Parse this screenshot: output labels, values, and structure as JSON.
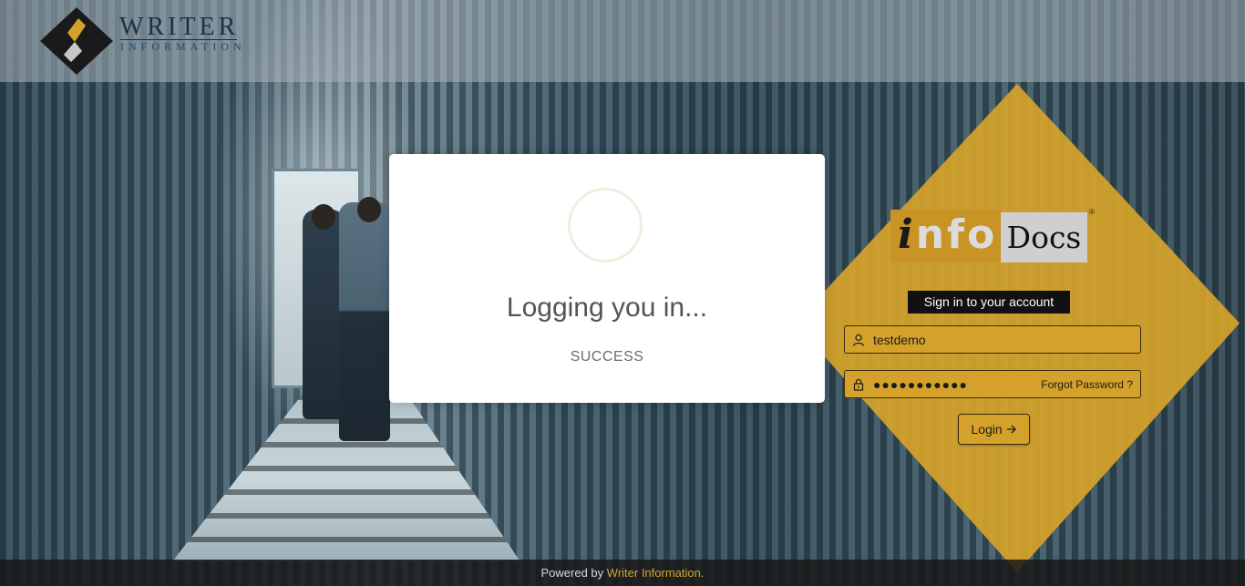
{
  "brand": {
    "name": "WRITER",
    "subtitle": "INFORMATION"
  },
  "product_logo": {
    "part1_first_letter": "i",
    "part1_rest": "nfo",
    "part2": "Docs",
    "registered": "®"
  },
  "login_form": {
    "title": "Sign in to your account",
    "username_value": "testdemo",
    "password_mask": "●●●●●●●●●●●",
    "forgot_password_label": "Forgot Password ?",
    "login_button_label": "Login",
    "login_button_icon": "arrow-right-icon"
  },
  "modal": {
    "title": "Logging you in...",
    "status": "SUCCESS"
  },
  "footer": {
    "prefix": "Powered by ",
    "link_text": "Writer Information."
  },
  "colors": {
    "accent": "#d4a22a",
    "dark": "#111111",
    "spinner_ring": "#e5f3df"
  }
}
